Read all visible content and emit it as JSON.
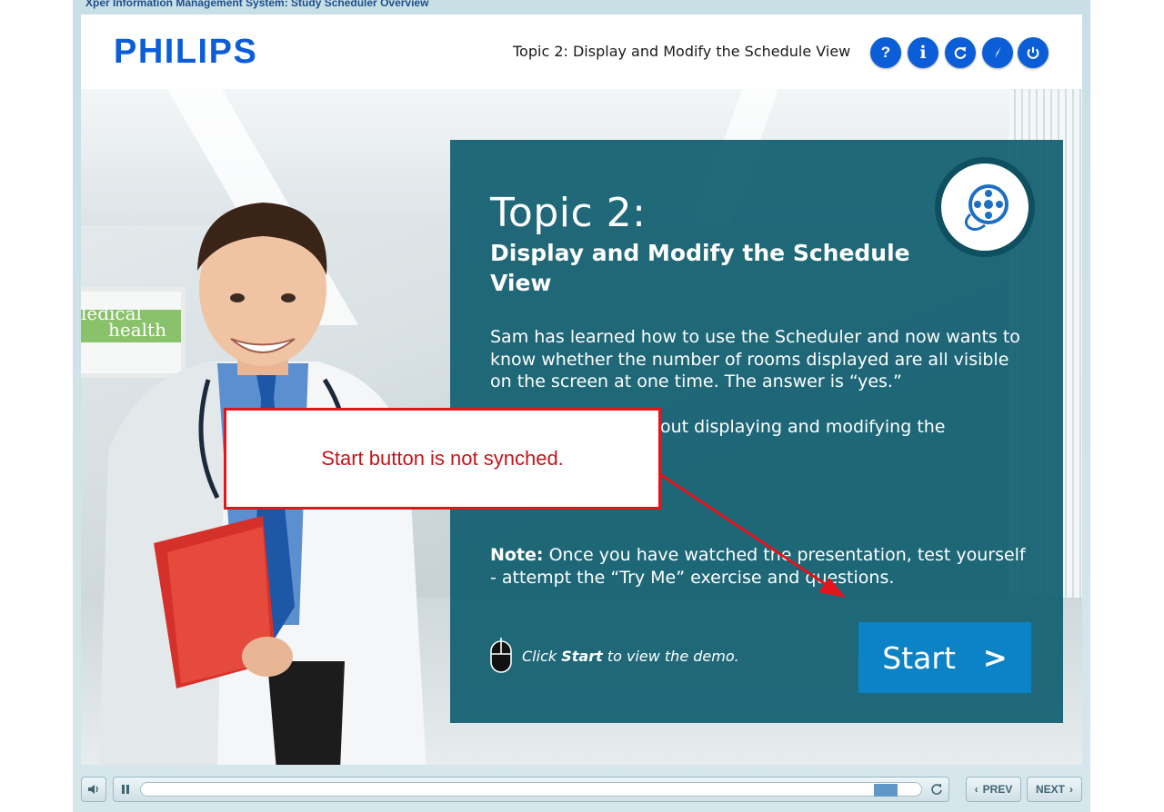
{
  "window": {
    "title": "Xper Information Management System: Study Scheduler Overview"
  },
  "header": {
    "logo": "PHILIPS",
    "topic": "Topic 2: Display and Modify the Schedule View",
    "buttons": [
      {
        "icon": "help-icon",
        "label": "?"
      },
      {
        "icon": "info-icon",
        "label": "i"
      },
      {
        "icon": "refresh-icon",
        "label": ""
      },
      {
        "icon": "compass-icon",
        "label": ""
      },
      {
        "icon": "power-icon",
        "label": ""
      }
    ],
    "accent_color": "#0b5ed7"
  },
  "panel": {
    "topic_number": "Topic 2:",
    "topic_title": "Display and Modify the Schedule View",
    "description": "Sam has learned how to use the Scheduler and now wants to know whether the number of rooms displayed are all visible on the screen at one time. The answer is “yes.”",
    "description2_visible": "out displaying and modifying the",
    "note_label": "Note:",
    "note_text": " Once you have watched the presentation, test yourself - attempt the “Try Me” exercise and questions.",
    "hint_prefix": "Click ",
    "hint_bold": "Start",
    "hint_suffix": " to view the demo.",
    "start_label": "Start",
    "start_arrow": ">",
    "panel_color": "#115f70",
    "start_color": "#0c83c6"
  },
  "poster": {
    "line1": "ledical",
    "line2": "health"
  },
  "callout": {
    "text": "Start button is not synched.",
    "border_color": "#e2141c"
  },
  "player": {
    "prev_label": "PREV",
    "next_label": "NEXT",
    "progress": 0.97
  }
}
